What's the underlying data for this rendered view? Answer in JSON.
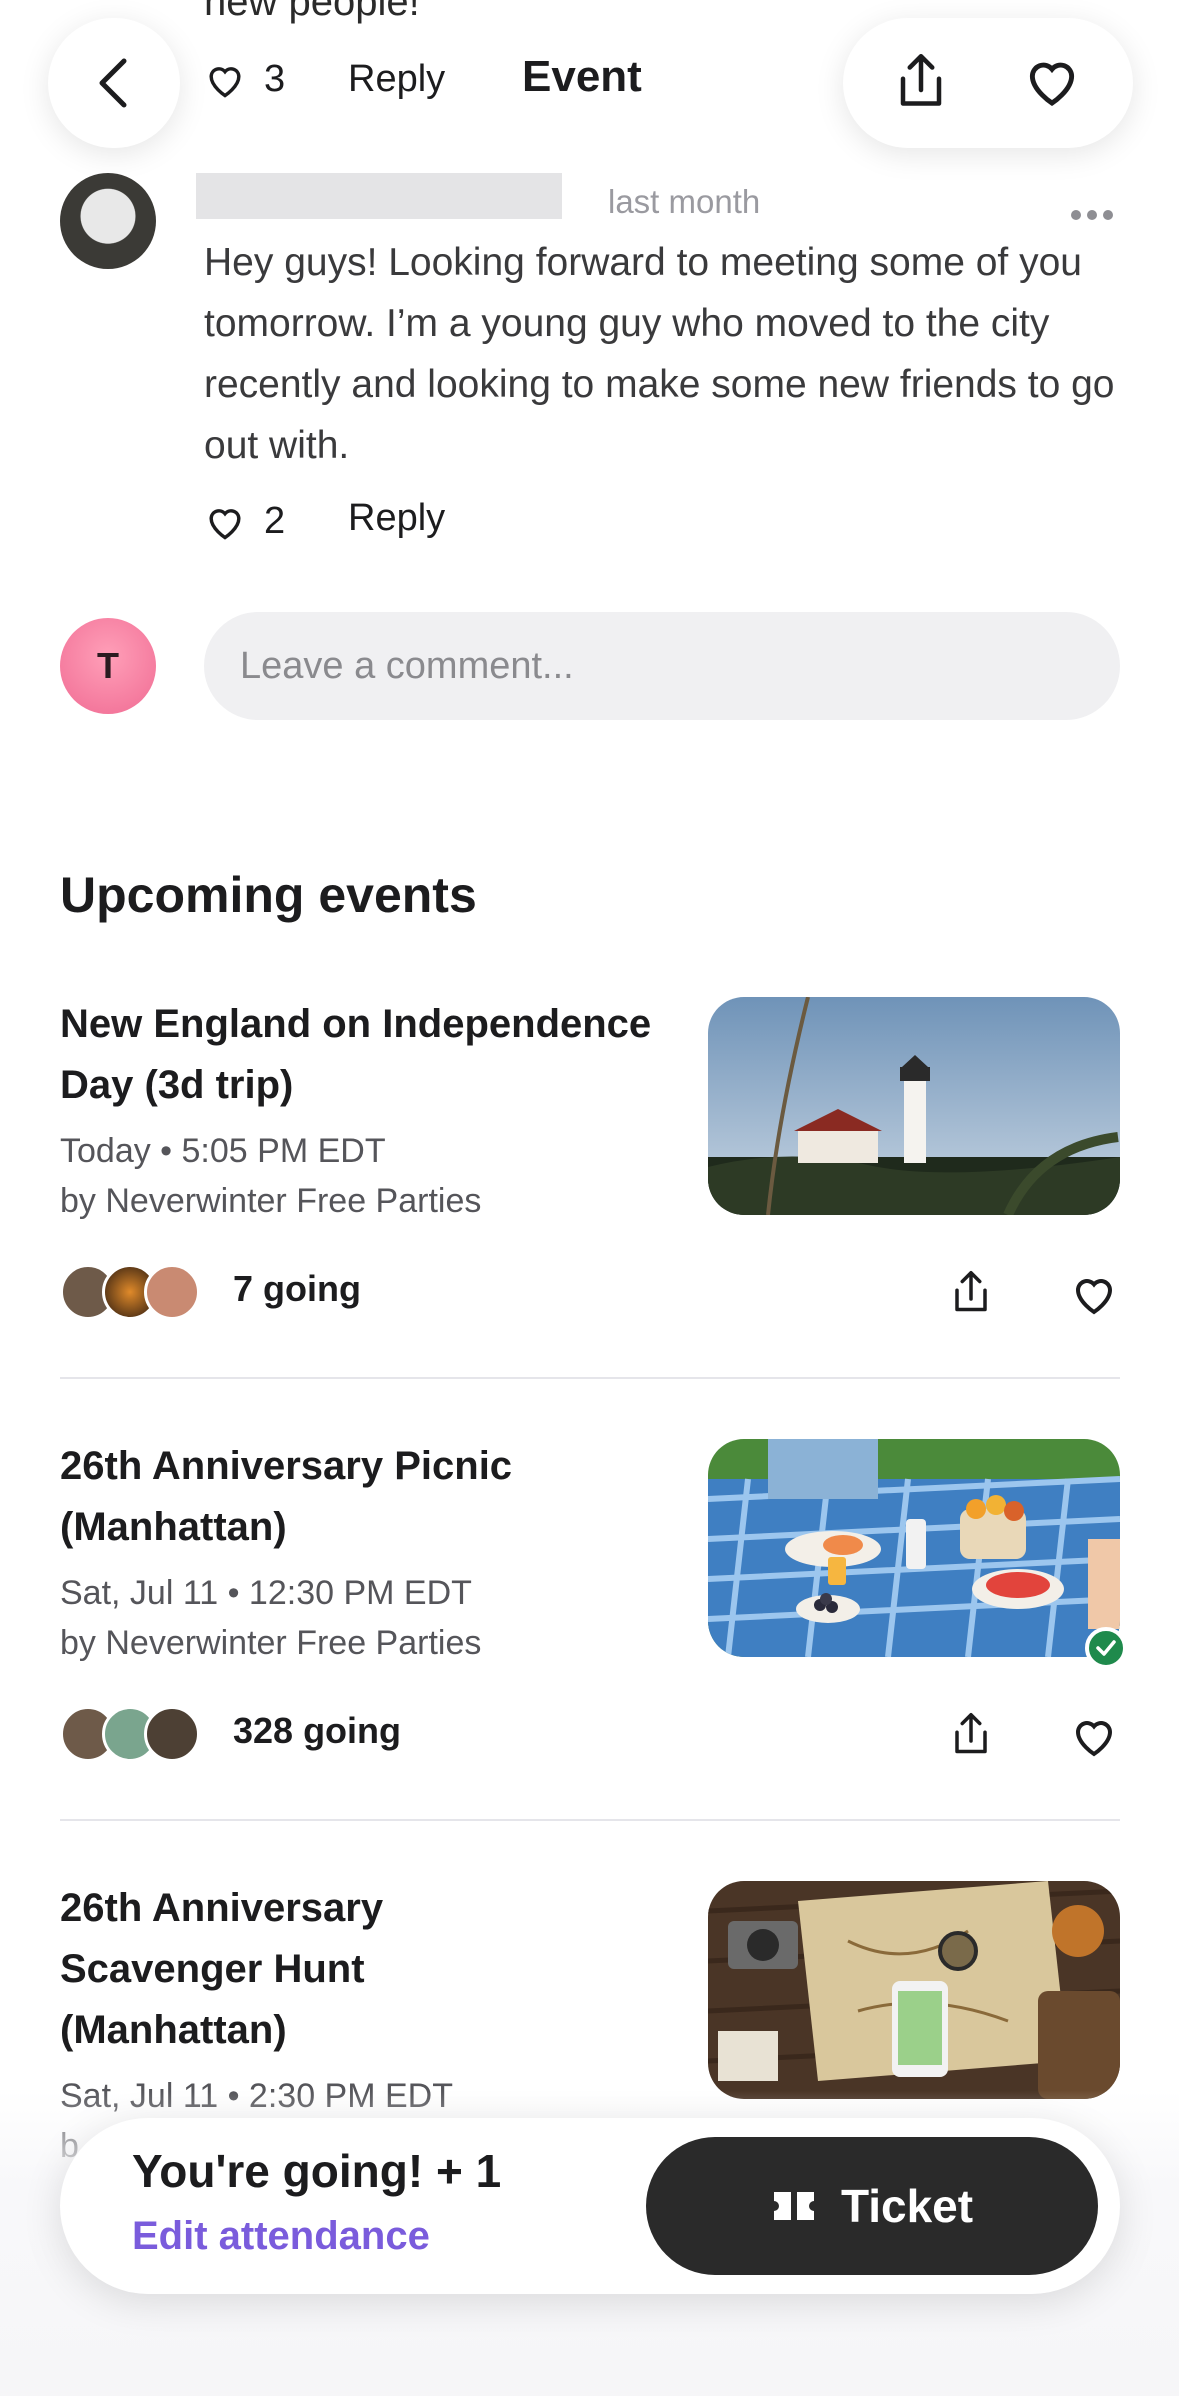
{
  "top_partial_text": "new people!",
  "header": {
    "title": "Event",
    "previous_comment_likes": "3",
    "previous_comment_reply": "Reply"
  },
  "comment": {
    "timestamp": "last month",
    "body": "Hey guys! Looking forward to meeting some of you tomorrow. I’m a young guy who moved to the city recently and looking to make some new friends to go out with.",
    "likes": "2",
    "reply_label": "Reply"
  },
  "compose": {
    "avatar_initial": "T",
    "placeholder": "Leave a comment..."
  },
  "upcoming": {
    "section_title": "Upcoming events",
    "events": [
      {
        "title": "New England on Independence Day (3d trip)",
        "time": "Today • 5:05 PM EDT",
        "organizer": "by Neverwinter Free Parties",
        "going": "7 going"
      },
      {
        "title": "26th Anniversary Picnic (Manhattan)",
        "time": "Sat, Jul 11 • 12:30 PM EDT",
        "organizer": "by Neverwinter Free Parties",
        "going": "328 going"
      },
      {
        "title": "26th Anniversary Scavenger Hunt (Manhattan)",
        "time": "Sat, Jul 11 • 2:30 PM EDT",
        "organizer": "b"
      }
    ]
  },
  "bottom_bar": {
    "status": "You're going! + 1",
    "edit_label": "Edit attendance",
    "ticket_label": "Ticket"
  },
  "colors": {
    "accent_purple": "#7a5cdc",
    "ticket_bg": "#2a2a2a",
    "check_green": "#1f8a4c",
    "avatar_pink": "#f06b93"
  }
}
